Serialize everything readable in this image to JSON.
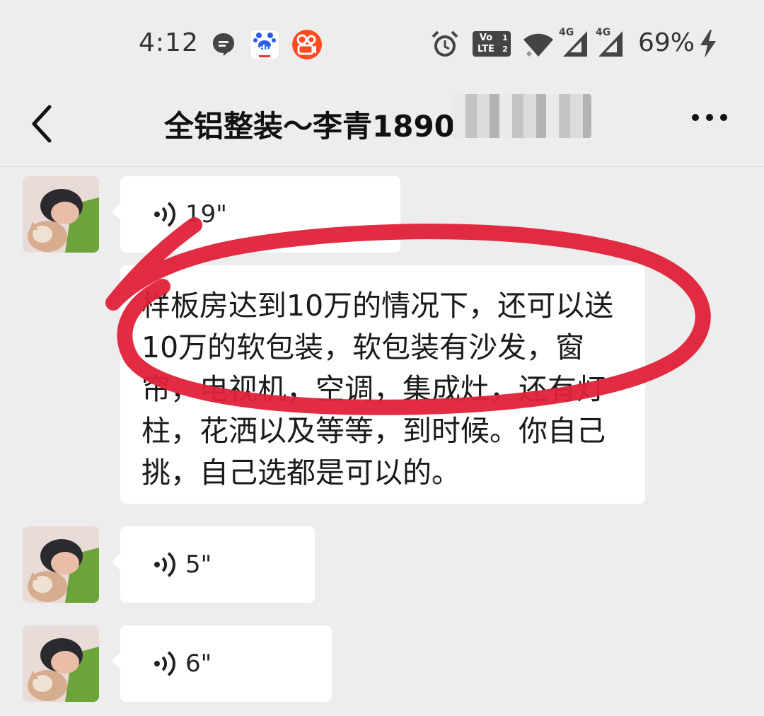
{
  "status_bar": {
    "time": "4:12",
    "battery": "69%",
    "network_1": "4G",
    "network_2": "4G",
    "volte": "Vo LTE",
    "sim": "1 2",
    "baidu_logo": "du"
  },
  "header": {
    "title": "全铝整装～李青1890"
  },
  "messages": [
    {
      "type": "voice",
      "duration": "19\""
    },
    {
      "type": "text",
      "text": "样板房达到10万的情况下，还可以送10万的软包装，软包装有沙发，窗帘，电视机，空调，集成灶，还有灯柱，花洒以及等等，到时候。你自己挑，自己选都是可以的。"
    },
    {
      "type": "voice",
      "duration": "5\""
    },
    {
      "type": "voice",
      "duration": "6\""
    }
  ],
  "colors": {
    "background": "#ededed",
    "bubble": "#ffffff",
    "annotation": "#e0213a"
  },
  "icons": [
    "chat-notification-icon",
    "baidu-icon",
    "kuaishou-icon",
    "alarm-icon",
    "volte-icon",
    "wifi-icon",
    "signal-icon",
    "charging-icon",
    "back-icon",
    "more-icon",
    "voice-icon"
  ]
}
